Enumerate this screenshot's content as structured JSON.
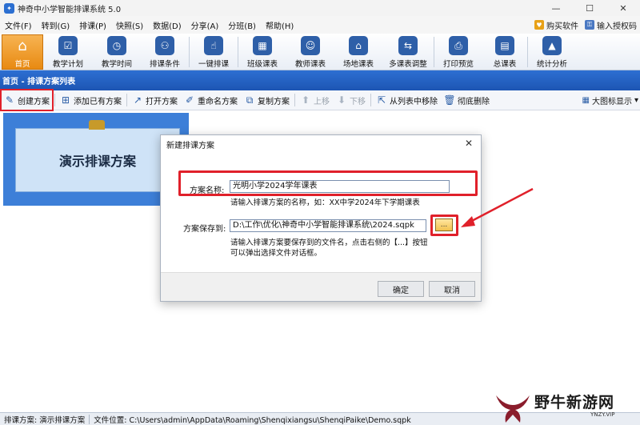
{
  "window": {
    "title": "神奇中小学智能排课系统 5.0",
    "controls": [
      "—",
      "☐",
      "✕"
    ]
  },
  "menu": {
    "items": [
      "文件(F)",
      "转到(G)",
      "排课(P)",
      "快照(S)",
      "数据(D)",
      "分享(A)",
      "分班(B)",
      "帮助(H)"
    ],
    "buy_label": "购买软件",
    "license_label": "输入授权码"
  },
  "ribbon": {
    "items": [
      {
        "label": "首页",
        "icon": "home-icon",
        "glyph": "⌂"
      },
      {
        "label": "教学计划",
        "icon": "clipboard-icon",
        "glyph": "☑"
      },
      {
        "label": "教学时间",
        "icon": "clock-icon",
        "glyph": "◷"
      },
      {
        "label": "排课条件",
        "icon": "nodes-icon",
        "glyph": "⚇"
      },
      {
        "label": "一键排课",
        "icon": "hand-icon",
        "glyph": "☝"
      },
      {
        "label": "班级课表",
        "icon": "grid-icon",
        "glyph": "▦"
      },
      {
        "label": "教师课表",
        "icon": "teacher-icon",
        "glyph": "☺"
      },
      {
        "label": "场地课表",
        "icon": "building-icon",
        "glyph": "⌂"
      },
      {
        "label": "多课表调整",
        "icon": "adjust-icon",
        "glyph": "⇆"
      },
      {
        "label": "打印预览",
        "icon": "printer-icon",
        "glyph": "⎙"
      },
      {
        "label": "总课表",
        "icon": "schedule-icon",
        "glyph": "▤"
      },
      {
        "label": "统计分析",
        "icon": "chart-icon",
        "glyph": "▲"
      }
    ]
  },
  "breadcrumb": "首页 - 排课方案列表",
  "commands": {
    "create": "创建方案",
    "add_existing": "添加已有方案",
    "open": "打开方案",
    "rename": "重命名方案",
    "copy": "复制方案",
    "move_up": "上移",
    "move_down": "下移",
    "remove": "从列表中移除",
    "delete": "彻底删除",
    "view": "大图标显示"
  },
  "plan_card": {
    "title": "演示排课方案"
  },
  "dialog": {
    "title": "新建排课方案",
    "name_label": "方案名称:",
    "name_value": "光明小学2024学年课表",
    "name_hint": "请输入排课方案的名称，如：XX中学2024年下学期课表",
    "path_label": "方案保存到:",
    "path_value": "D:\\工作\\优化\\神奇中小学智能排课系统\\2024.sqpk",
    "browse_label": "...",
    "path_hint": "请输入排课方案要保存到的文件名，点击右侧的【...】按钮可以弹出选择文件对话框。",
    "ok": "确定",
    "cancel": "取消"
  },
  "status": {
    "plan": "排课方案: 演示排课方案",
    "location": "文件位置: C:\\Users\\admin\\AppData\\Roaming\\Shenqixiangsu\\ShenqiPaike\\Demo.sqpk"
  },
  "watermark": {
    "text": "野牛新游网",
    "sub": "YNZY.VIP"
  },
  "colors": {
    "accent": "#1d55b3",
    "highlight": "#e0202a",
    "active": "#e88a12"
  }
}
